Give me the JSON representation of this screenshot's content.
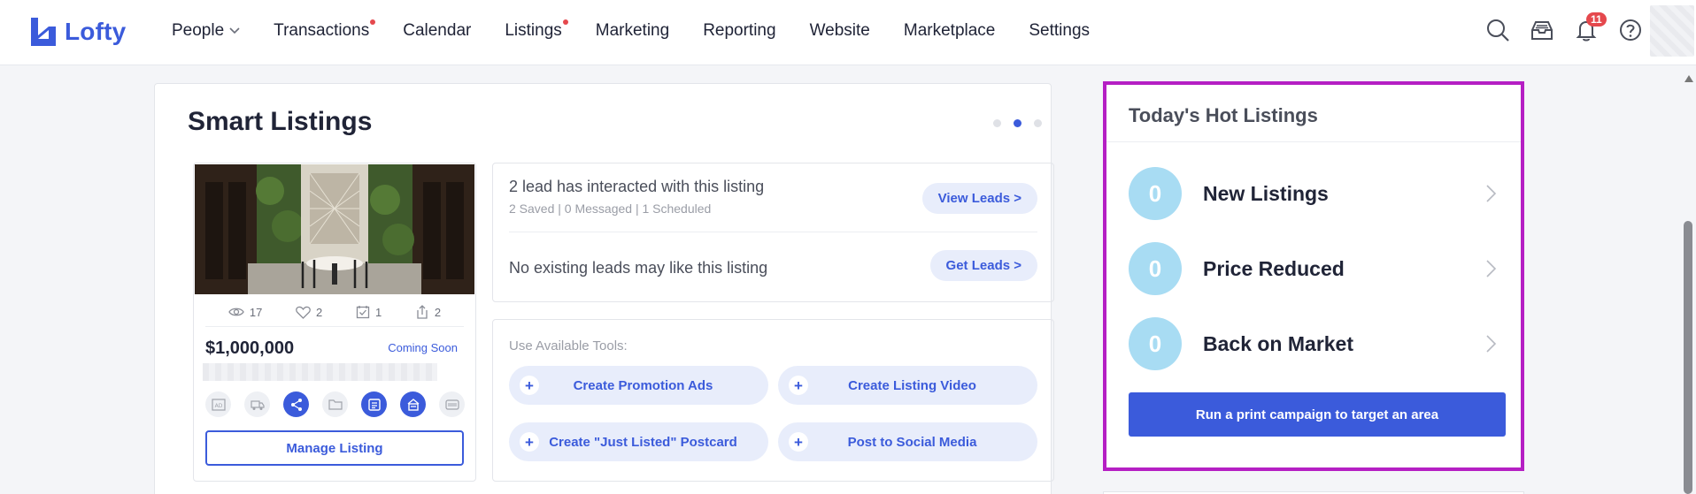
{
  "brand": {
    "name": "Lofty",
    "color": "#3b5bdb"
  },
  "nav": {
    "items": [
      {
        "label": "People",
        "has_dropdown": true,
        "dot": false
      },
      {
        "label": "Transactions",
        "dot": true
      },
      {
        "label": "Calendar",
        "dot": false
      },
      {
        "label": "Listings",
        "dot": true
      },
      {
        "label": "Marketing",
        "dot": false
      },
      {
        "label": "Reporting",
        "dot": false
      },
      {
        "label": "Website",
        "dot": false
      },
      {
        "label": "Marketplace",
        "dot": false
      },
      {
        "label": "Settings",
        "dot": false
      }
    ],
    "icons": [
      "search-icon",
      "inbox-icon",
      "bell-icon",
      "help-icon"
    ],
    "notification_count": "11"
  },
  "smart_listings": {
    "title": "Smart Listings",
    "carousel": {
      "count": 3,
      "active_index": 1
    },
    "listing": {
      "views": "17",
      "favorites": "2",
      "scheduled": "1",
      "shares": "2",
      "price": "$1,000,000",
      "status": "Coming Soon",
      "tool_icons": [
        "ad-icon",
        "truck-icon",
        "share-icon",
        "folder-icon",
        "flyer-icon",
        "sign-icon",
        "qr-icon"
      ],
      "manage_label": "Manage Listing"
    },
    "leads": {
      "interacted_text": "2 lead has interacted with this listing",
      "interacted_sub": "2 Saved | 0 Messaged | 1 Scheduled",
      "view_leads_label": "View Leads >",
      "no_leads_text": "No existing leads may like this listing",
      "get_leads_label": "Get Leads >"
    },
    "tools": {
      "label": "Use Available Tools:",
      "buttons": [
        "Create Promotion Ads",
        "Create Listing Video",
        "Create \"Just Listed\" Postcard",
        "Post to Social Media"
      ]
    }
  },
  "hot_listings": {
    "title": "Today's Hot Listings",
    "rows": [
      {
        "count": "0",
        "label": "New Listings"
      },
      {
        "count": "0",
        "label": "Price Reduced"
      },
      {
        "count": "0",
        "label": "Back on Market"
      }
    ],
    "campaign_label": "Run a print campaign to target an area",
    "highlight_color": "#b51fc4"
  }
}
